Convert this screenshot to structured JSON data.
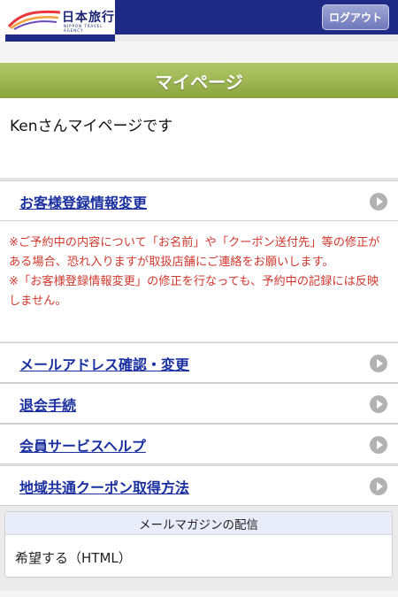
{
  "header": {
    "logo_text": "日本旅行",
    "logo_subtext": "NIPPON TRAVEL AGENCY",
    "logout_label": "ログアウト"
  },
  "page": {
    "title": "マイページ",
    "greeting": "Kenさんマイページです"
  },
  "menu": {
    "items": [
      {
        "label": "お客様登録情報変更"
      },
      {
        "label": "メールアドレス確認・変更"
      },
      {
        "label": "退会手続"
      },
      {
        "label": "会員サービスヘルプ"
      },
      {
        "label": "地域共通クーポン取得方法"
      }
    ]
  },
  "notice": {
    "line1": "※ご予約中の内容について「お名前」や「クーポン送付先」等の修正がある場合、恐れ入りますが取扱店舗にご連絡をお願いします。",
    "line2": "※「お客様登録情報変更」の修正を行なっても、予約中の記録には反映しません。"
  },
  "mail_magazine": {
    "title": "メールマガジンの配信",
    "value": "希望する（HTML）"
  },
  "colors": {
    "brand_navy": "#1f2a86",
    "header_green": "#8ba53e",
    "link_blue": "#1a2fa0",
    "notice_red": "#d0382e"
  },
  "icons": [
    "logo-swoosh-icon",
    "arrow-right-circle-icon"
  ]
}
